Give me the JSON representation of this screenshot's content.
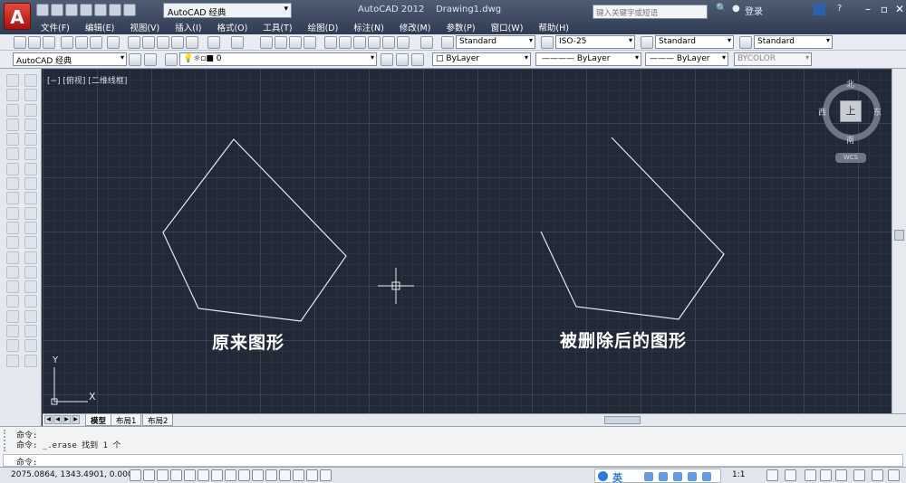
{
  "titlebar": {
    "workspace": "AutoCAD 经典",
    "app_title": "AutoCAD 2012",
    "doc_title": "Drawing1.dwg",
    "search_placeholder": "键入关键字或短语",
    "login": "登录",
    "menu": [
      "文件(F)",
      "编辑(E)",
      "视图(V)",
      "插入(I)",
      "格式(O)",
      "工具(T)",
      "绘图(D)",
      "标注(N)",
      "修改(M)",
      "参数(P)",
      "窗口(W)",
      "帮助(H)"
    ]
  },
  "toolbar1": {
    "text_style": "Standard",
    "dim_style": "ISO-25",
    "table_style": "Standard",
    "multileader_style": "Standard"
  },
  "toolbar2": {
    "workspace": "AutoCAD 经典",
    "layer": "0",
    "color": "ByLayer",
    "linetype": "ByLayer",
    "lineweight": "ByLayer",
    "plotstyle": "BYCOLOR"
  },
  "canvas": {
    "viewport_label": "[−] [俯视] [二维线框]",
    "left_label": "原来图形",
    "right_label": "被删除后的图形",
    "ucs_x": "X",
    "ucs_y": "Y"
  },
  "viewcube": {
    "north": "北",
    "south": "南",
    "east": "东",
    "west": "西",
    "top": "上",
    "wcs": "WCS"
  },
  "tabs": [
    "模型",
    "布局1",
    "布局2"
  ],
  "command": {
    "lines": [
      "命令:",
      "命令: _.erase 找到 1 个",
      "命令:"
    ],
    "prompt": "命令:"
  },
  "status": {
    "coords": "2075.0864, 1343.4901, 0.0000",
    "ime_lang": "英",
    "scale": "1:1"
  },
  "colors": {
    "canvas_bg": "#212836",
    "shape_stroke": "#e6e9ef",
    "titlebar": "#2f3b52"
  }
}
